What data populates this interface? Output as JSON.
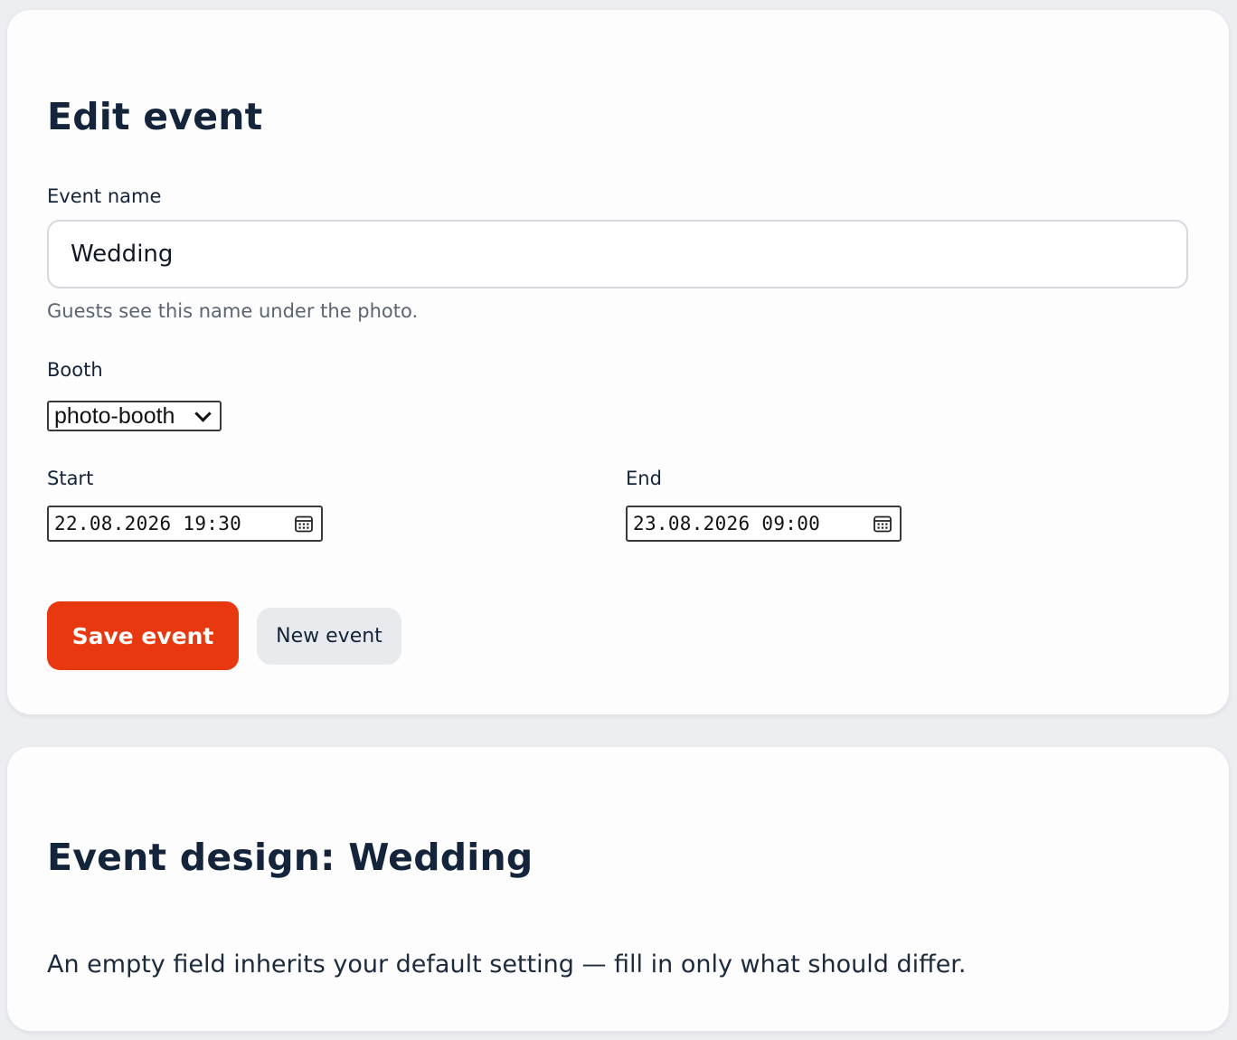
{
  "edit_event": {
    "title": "Edit event",
    "event_name": {
      "label": "Event name",
      "value": "Wedding",
      "help": "Guests see this name under the photo."
    },
    "booth": {
      "label": "Booth",
      "selected": "photo-booth"
    },
    "start": {
      "label": "Start",
      "value": "22.08.2026 19:30"
    },
    "end": {
      "label": "End",
      "value": "23.08.2026 09:00"
    },
    "save_button": "Save event",
    "new_button": "New event"
  },
  "event_design": {
    "title": "Event design: Wedding",
    "description": "An empty field inherits your default setting — fill in only what should differ."
  },
  "colors": {
    "accent": "#e8380f",
    "heading": "#14243a",
    "background": "#eceef1",
    "card": "#fdfdfd"
  },
  "icons": {
    "date_picker": "calendar-icon",
    "select": "chevron-down-icon"
  }
}
